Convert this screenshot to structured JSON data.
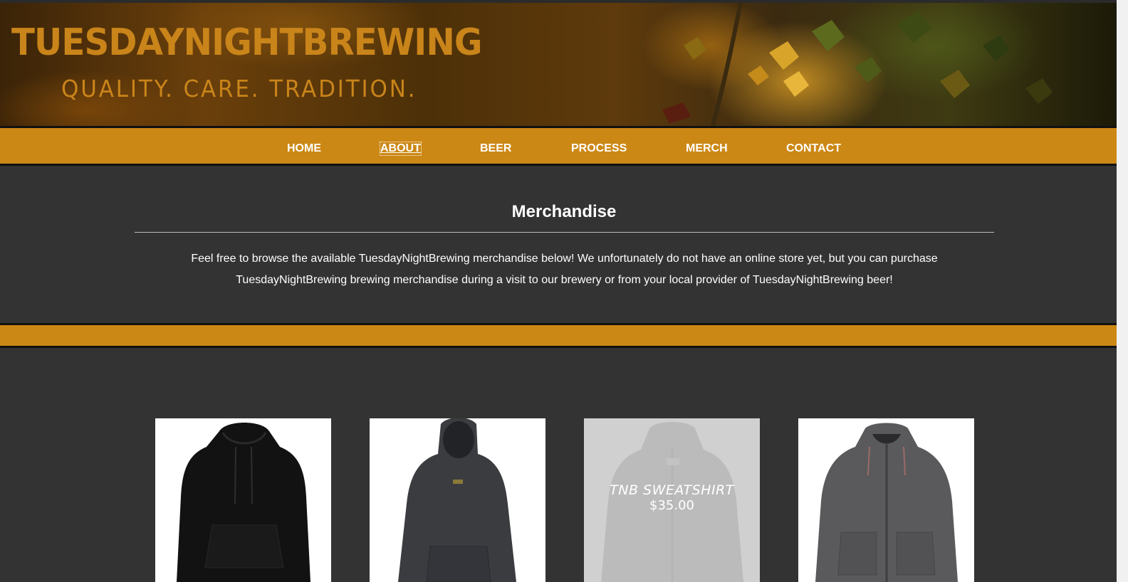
{
  "header": {
    "brand_title": "TUESDAYNIGHTBREWING",
    "tagline": "QUALITY. CARE. TRADITION."
  },
  "nav": {
    "items": [
      {
        "label": "HOME"
      },
      {
        "label": "ABOUT",
        "focused": true
      },
      {
        "label": "BEER"
      },
      {
        "label": "PROCESS"
      },
      {
        "label": "MERCH"
      },
      {
        "label": "CONTACT"
      }
    ]
  },
  "intro": {
    "title": "Merchandise",
    "text": "Feel free to browse the available TuesdayNightBrewing merchandise below! We unfortunately do not have an online store yet, but you can purchase TuesdayNightBrewing brewing merchandise during a visit to our brewery or from your local provider of TuesdayNightBrewing beer!"
  },
  "products": [
    {
      "image": "black-pullover-hoodie"
    },
    {
      "image": "charcoal-pullover-hoodie"
    },
    {
      "image": "grey-zip-hoodie",
      "hovered": true,
      "name": "TNB SWEATSHIRT",
      "price": "$35.00"
    },
    {
      "image": "grey-zip-hoodie-2"
    }
  ],
  "colors": {
    "accent": "#cc8815",
    "background": "#333333",
    "brand_text": "#c9841a"
  }
}
